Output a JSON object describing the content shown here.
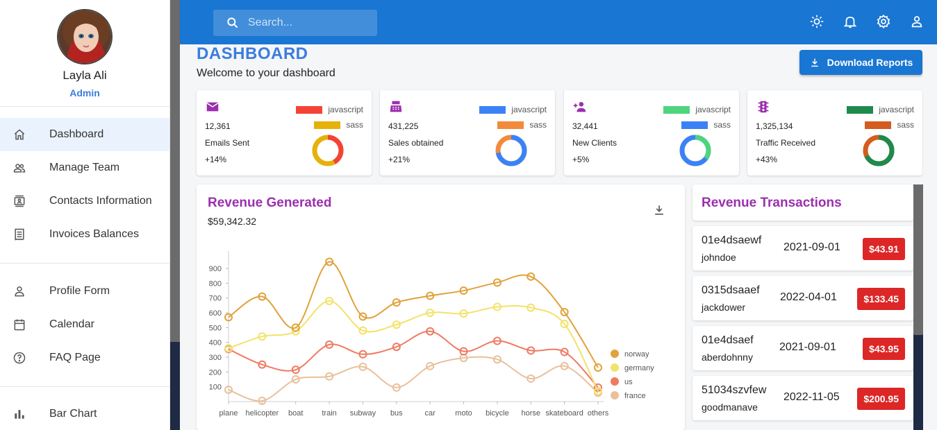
{
  "profile": {
    "name": "Layla Ali",
    "role": "Admin"
  },
  "sidebar": {
    "groups": [
      [
        {
          "label": "Dashboard",
          "icon": "home-icon",
          "active": true
        },
        {
          "label": "Manage Team",
          "icon": "people-icon"
        },
        {
          "label": "Contacts Information",
          "icon": "contacts-icon"
        },
        {
          "label": "Invoices Balances",
          "icon": "receipt-icon"
        }
      ],
      [
        {
          "label": "Profile Form",
          "icon": "person-icon"
        },
        {
          "label": "Calendar",
          "icon": "calendar-icon"
        },
        {
          "label": "FAQ Page",
          "icon": "help-icon"
        }
      ],
      [
        {
          "label": "Bar Chart",
          "icon": "bar-chart-icon"
        }
      ]
    ]
  },
  "topbar": {
    "search_placeholder": "Search...",
    "icons": [
      "light-mode-icon",
      "notifications-icon",
      "settings-icon",
      "person-icon"
    ]
  },
  "header": {
    "title": "DASHBOARD",
    "subtitle": "Welcome to your dashboard",
    "download_label": "Download Reports"
  },
  "stats": [
    {
      "value": "12,361",
      "label": "Emails Sent",
      "increase": "+14%",
      "icon": "email-icon",
      "legend": [
        {
          "name": "javascript",
          "color": "#f44336"
        },
        {
          "name": "sass",
          "color": "#e5b10a"
        }
      ],
      "split": 0.42
    },
    {
      "value": "431,225",
      "label": "Sales obtained",
      "increase": "+21%",
      "icon": "point-of-sale-icon",
      "legend": [
        {
          "name": "javascript",
          "color": "#3b82f6"
        },
        {
          "name": "sass",
          "color": "#f28a3c"
        }
      ],
      "split": 0.72
    },
    {
      "value": "32,441",
      "label": "New Clients",
      "increase": "+5%",
      "icon": "person-add-icon",
      "legend": [
        {
          "name": "javascript",
          "color": "#4fd47e"
        },
        {
          "name": "sass",
          "color": "#3b82f6"
        }
      ],
      "split": 0.35
    },
    {
      "value": "1,325,134",
      "label": "Traffic Received",
      "increase": "+43%",
      "icon": "traffic-icon",
      "legend": [
        {
          "name": "javascript",
          "color": "#1f8a4c"
        },
        {
          "name": "sass",
          "color": "#d35c1f"
        }
      ],
      "split": 0.68
    }
  ],
  "revenue": {
    "title": "Revenue Generated",
    "amount": "$59,342.32"
  },
  "chart_data": {
    "type": "line",
    "categories": [
      "plane",
      "helicopter",
      "boat",
      "train",
      "subway",
      "bus",
      "car",
      "moto",
      "bicycle",
      "horse",
      "skateboard",
      "others"
    ],
    "series": [
      {
        "name": "norway",
        "color": "#e0a23a",
        "values": [
          570,
          710,
          500,
          945,
          575,
          670,
          715,
          750,
          805,
          845,
          605,
          230
        ]
      },
      {
        "name": "germany",
        "color": "#f2e26a",
        "values": [
          360,
          440,
          475,
          680,
          480,
          520,
          600,
          595,
          640,
          635,
          525,
          70
        ]
      },
      {
        "name": "us",
        "color": "#ef7a62",
        "values": [
          355,
          250,
          215,
          385,
          320,
          370,
          475,
          340,
          410,
          345,
          335,
          95
        ]
      },
      {
        "name": "france",
        "color": "#e9c09a",
        "values": [
          80,
          5,
          150,
          170,
          235,
          95,
          240,
          295,
          285,
          155,
          240,
          60
        ]
      }
    ],
    "yticks": [
      100,
      200,
      300,
      400,
      500,
      600,
      700,
      800,
      900
    ],
    "ylim": [
      0,
      980
    ],
    "legend_position": "right"
  },
  "transactions": {
    "title": "Revenue Transactions",
    "rows": [
      {
        "id": "01e4dsaewf",
        "user": "johndoe",
        "date": "2021-09-01",
        "cost": "$43.91"
      },
      {
        "id": "0315dsaaef",
        "user": "jackdower",
        "date": "2022-04-01",
        "cost": "$133.45"
      },
      {
        "id": "01e4dsaef",
        "user": "aberdohnny",
        "date": "2021-09-01",
        "cost": "$43.95"
      },
      {
        "id": "51034szvfew",
        "user": "goodmanave",
        "date": "2022-11-05",
        "cost": "$200.95"
      }
    ]
  }
}
